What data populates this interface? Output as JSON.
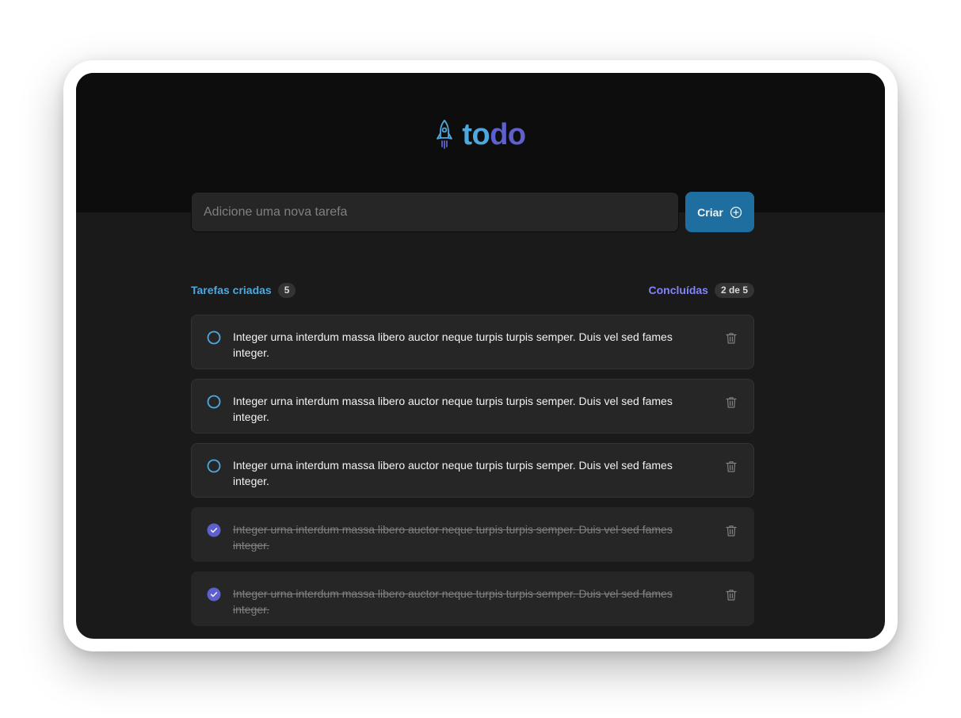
{
  "app": {
    "logo_icon": "rocket-icon",
    "logo_part1": "to",
    "logo_part2": "do",
    "colors": {
      "blue": "#4ea8de",
      "purple": "#5e60ce",
      "purple_light": "#8284fa",
      "button": "#1e6f9f"
    }
  },
  "new_task": {
    "placeholder": "Adicione uma nova tarefa",
    "value": "",
    "create_label": "Criar",
    "create_icon": "plus-circle-icon"
  },
  "counters": {
    "created_label": "Tarefas criadas",
    "created_count": "5",
    "done_label": "Concluídas",
    "done_count": "2 de 5"
  },
  "tasks": [
    {
      "text": "Integer urna interdum massa libero auctor neque turpis turpis semper. Duis vel sed fames integer.",
      "completed": false
    },
    {
      "text": "Integer urna interdum massa libero auctor neque turpis turpis semper. Duis vel sed fames integer.",
      "completed": false
    },
    {
      "text": "Integer urna interdum massa libero auctor neque turpis turpis semper. Duis vel sed fames integer.",
      "completed": false
    },
    {
      "text": "Integer urna interdum massa libero auctor neque turpis turpis semper. Duis vel sed fames integer.",
      "completed": true
    },
    {
      "text": "Integer urna interdum massa libero auctor neque turpis turpis semper. Duis vel sed fames integer.",
      "completed": true
    }
  ]
}
